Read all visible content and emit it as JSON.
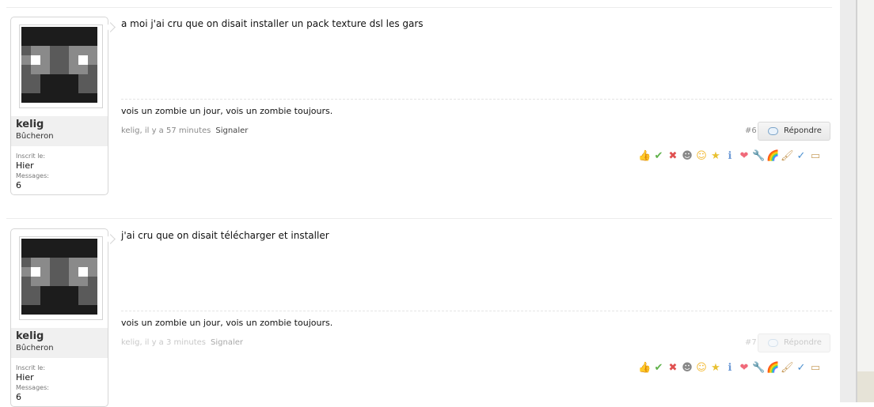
{
  "posts": [
    {
      "username": "kelig",
      "rank": "Bûcheron",
      "joined_label": "Inscrit le:",
      "joined_value": "Hier",
      "messages_label": "Messages:",
      "messages_value": "6",
      "message": "a moi j'ai cru que on disait installer un pack texture dsl les gars",
      "signature": "vois un zombie un jour, vois un zombie toujours.",
      "meta": "kelig, il y a 57 minutes",
      "report": "Signaler",
      "post_number": "#6",
      "reply_label": "Répondre"
    },
    {
      "username": "kelig",
      "rank": "Bûcheron",
      "joined_label": "Inscrit le:",
      "joined_value": "Hier",
      "messages_label": "Messages:",
      "messages_value": "6",
      "message": "j'ai cru que on disait télécharger et installer",
      "signature": "vois un zombie un jour, vois un zombie toujours.",
      "meta": "kelig, il y a 3 minutes",
      "report": "Signaler",
      "post_number": "#7",
      "reply_label": "Répondre"
    }
  ],
  "reaction_icons": [
    "thumbs-up-icon",
    "checkmark-icon",
    "x-icon",
    "troll-face-icon",
    "smiley-icon",
    "award-icon",
    "info-icon",
    "heart-icon",
    "wrench-icon",
    "rainbow-icon",
    "paintbrush-icon",
    "spellcheck-icon",
    "box-icon"
  ],
  "reaction_glyphs": [
    "👍",
    "✔",
    "✖",
    "☻",
    "☺",
    "★",
    "ℹ",
    "❤",
    "🔧",
    "🌈",
    "🖌",
    "✓",
    "▭"
  ],
  "reaction_colors": [
    "#e0a04a",
    "#5fb24a",
    "#e05050",
    "#888888",
    "#f2b830",
    "#e8c030",
    "#6d9ad6",
    "#f06a7a",
    "#d9a050",
    "#e2793a",
    "#c89c5c",
    "#4a8fd0",
    "#c9a060"
  ],
  "avatar_pixels": [
    "1111111111111111",
    "1111111111111111",
    "2333332222333332",
    "3340332222334033",
    "2233332222333322",
    "2222111111112222",
    "2222111111112222",
    "1111111111111111"
  ],
  "avatar_palette": {
    "0": "#ffffff",
    "1": "#1c1c1c",
    "2": "#5a5a5a",
    "3": "#8a8a8a",
    "4": "#ffffff"
  }
}
